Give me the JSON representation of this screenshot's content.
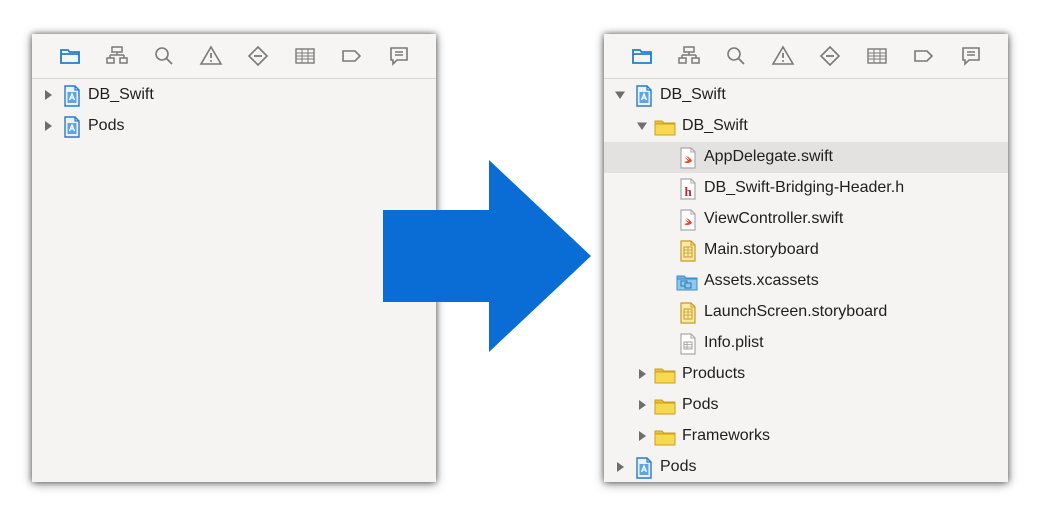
{
  "left_panel": {
    "toolbar_icons": [
      "project-navigator-icon",
      "symbol-navigator-icon",
      "find-navigator-icon",
      "issue-navigator-icon",
      "test-navigator-icon",
      "debug-navigator-icon",
      "breakpoint-navigator-icon",
      "report-navigator-icon"
    ],
    "items": [
      {
        "label": "DB_Swift",
        "icon": "project-file-icon",
        "expanded": false
      },
      {
        "label": "Pods",
        "icon": "project-file-icon",
        "expanded": false
      }
    ]
  },
  "right_panel": {
    "toolbar_icons": [
      "project-navigator-icon",
      "symbol-navigator-icon",
      "find-navigator-icon",
      "issue-navigator-icon",
      "test-navigator-icon",
      "debug-navigator-icon",
      "breakpoint-navigator-icon",
      "report-navigator-icon"
    ],
    "items": [
      {
        "label": "DB_Swift",
        "icon": "project-file-icon",
        "expanded": true
      },
      {
        "label": "DB_Swift",
        "icon": "folder-icon",
        "expanded": true
      },
      {
        "label": "AppDelegate.swift",
        "icon": "swift-file-icon",
        "selected": true
      },
      {
        "label": "DB_Swift-Bridging-Header.h",
        "icon": "header-file-icon"
      },
      {
        "label": "ViewController.swift",
        "icon": "swift-file-icon"
      },
      {
        "label": "Main.storyboard",
        "icon": "storyboard-file-icon"
      },
      {
        "label": "Assets.xcassets",
        "icon": "asset-catalog-icon"
      },
      {
        "label": "LaunchScreen.storyboard",
        "icon": "storyboard-file-icon"
      },
      {
        "label": "Info.plist",
        "icon": "plist-file-icon"
      },
      {
        "label": "Products",
        "icon": "folder-icon",
        "expanded": false
      },
      {
        "label": "Pods",
        "icon": "folder-icon",
        "expanded": false
      },
      {
        "label": "Frameworks",
        "icon": "folder-icon",
        "expanded": false
      },
      {
        "label": "Pods",
        "icon": "project-file-icon",
        "expanded": false
      }
    ]
  },
  "colors": {
    "accent_blue": "#1a7fd1",
    "arrow_blue": "#0a6dd6",
    "folder_yellow": "#f6d44c",
    "swift_orange": "#e8472e",
    "header_red": "#c2272d",
    "storyboard_yellow": "#e8b83a"
  }
}
